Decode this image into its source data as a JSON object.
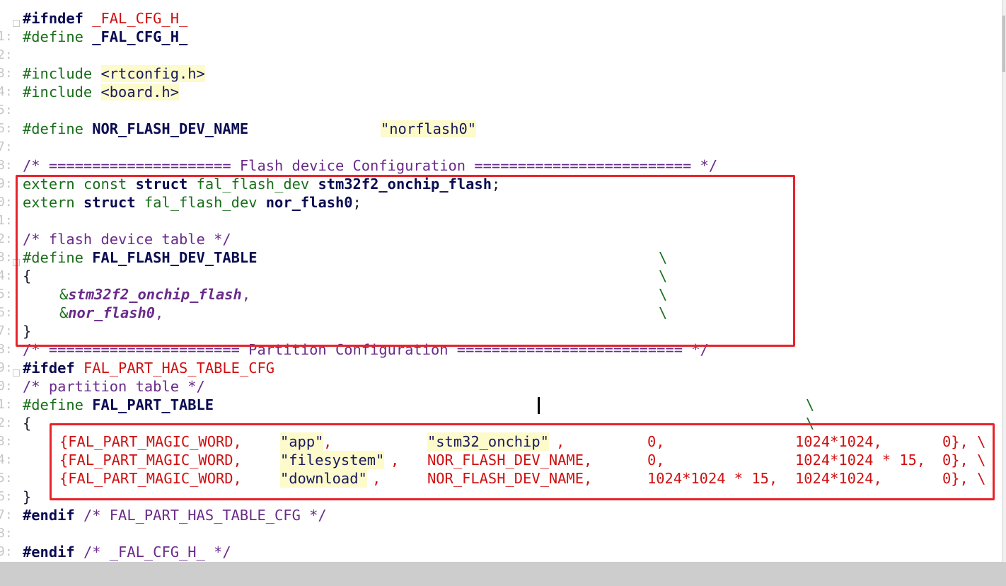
{
  "editor": {
    "lines": [
      {
        "num": "1:",
        "text": "#ifndef _FAL_CFG_H_"
      },
      {
        "num": "2:",
        "text": "#define _FAL_CFG_H_"
      },
      {
        "num": "3:",
        "text": ""
      },
      {
        "num": "4:",
        "text": "#include <rtconfig.h>"
      },
      {
        "num": "5:",
        "text": "#include <board.h>"
      },
      {
        "num": "6:",
        "text": ""
      },
      {
        "num": "7:",
        "text": "#define NOR_FLASH_DEV_NAME             \"norflash0\""
      },
      {
        "num": "8:",
        "text": ""
      },
      {
        "num": "9:",
        "text": "/* ===================== Flash device Configuration ========================= */"
      },
      {
        "num": "0:",
        "text": "extern const struct fal_flash_dev stm32f2_onchip_flash;"
      },
      {
        "num": "1:",
        "text": "extern struct fal_flash_dev nor_flash0;"
      },
      {
        "num": "2:",
        "text": ""
      },
      {
        "num": "3:",
        "text": "/* flash device table */"
      },
      {
        "num": "4:",
        "text": "#define FAL_FLASH_DEV_TABLE                                          \\"
      },
      {
        "num": "5:",
        "text": "{                                                                     \\"
      },
      {
        "num": "6:",
        "text": "    &stm32f2_onchip_flash,                                           \\"
      },
      {
        "num": "7:",
        "text": "    &nor_flash0,                                                     \\"
      },
      {
        "num": "8:",
        "text": "}"
      },
      {
        "num": "9:",
        "text": "/* ====================== Partition Configuration ========================== */"
      },
      {
        "num": "0:",
        "text": "#ifdef FAL_PART_HAS_TABLE_CFG"
      },
      {
        "num": "1:",
        "text": "/* partition table */"
      },
      {
        "num": "2:",
        "text": "#define FAL_PART_TABLE                                                          \\"
      },
      {
        "num": "3:",
        "text": "{                                                                               \\"
      },
      {
        "num": "4:",
        "text": "    {FAL_PART_MAGIC_WORD,   \"app\",          \"stm32_onchip\",        0,             1024*1024,      0}, \\"
      },
      {
        "num": "5:",
        "text": "    {FAL_PART_MAGIC_WORD,   \"filesystem\",   NOR_FLASH_DEV_NAME,     0,             1024*1024 * 15, 0}, \\"
      },
      {
        "num": "6:",
        "text": "    {FAL_PART_MAGIC_WORD,   \"download\",     NOR_FLASH_DEV_NAME,     1024*1024 * 15, 1024*1024,      0}, \\"
      },
      {
        "num": "7:",
        "text": "}"
      },
      {
        "num": "8:",
        "text": "#endif /* FAL_PART_HAS_TABLE_CFG */"
      },
      {
        "num": "9:",
        "text": ""
      },
      {
        "num": "0:",
        "text": "#endif /* _FAL_CFG_H_ */"
      }
    ]
  },
  "t": {
    "ifndef": "#ifndef",
    "fal_cfg_h": "_FAL_CFG_H_",
    "define": "#define",
    "include": "#include",
    "rtconfig": "<rtconfig.h>",
    "board": "<board.h>",
    "nor_name": "NOR_FLASH_DEV_NAME",
    "norflash0": "\"norflash0\"",
    "flash_cfg_comment": "/* ===================== Flash device Configuration ========================= */",
    "extern": "extern",
    "const": "const",
    "struct": "struct",
    "fal_flash_dev": "fal_flash_dev",
    "stm32_onchip_flash": "stm32f2_onchip_flash",
    "nor_flash0": "nor_flash0",
    "semicolon": ";",
    "table_comment": "/* flash device table */",
    "fal_flash_dev_table": "FAL_FLASH_DEV_TABLE",
    "lbrace": "{",
    "rbrace": "}",
    "amp": "&",
    "comma": ",",
    "backslash": "\\",
    "part_cfg_comment": "/* ====================== Partition Configuration ========================== */",
    "ifdef": "#ifdef",
    "fal_part_has_table_cfg": "FAL_PART_HAS_TABLE_CFG",
    "part_table_comment": "/* partition table */",
    "fal_part_table": "FAL_PART_TABLE",
    "magic": "{FAL_PART_MAGIC_WORD,",
    "app": "\"app\"",
    "filesystem": "\"filesystem\"",
    "download": "\"download\"",
    "stm32_onchip": "\"stm32_onchip\"",
    "nor_name_comma": "NOR_FLASH_DEV_NAME,",
    "zero_comma": "0,",
    "n1024": "1024",
    "star": "*",
    "n15": "15",
    "zero_end": "0}, \\",
    "endif": "#endif",
    "endif_part_comment": "/* FAL_PART_HAS_TABLE_CFG */",
    "endif_cfg_comment": "/* _FAL_CFG_H_ */"
  },
  "colors": {
    "highlight_box": "#e8232a",
    "string_bg": "#fdfacb"
  }
}
